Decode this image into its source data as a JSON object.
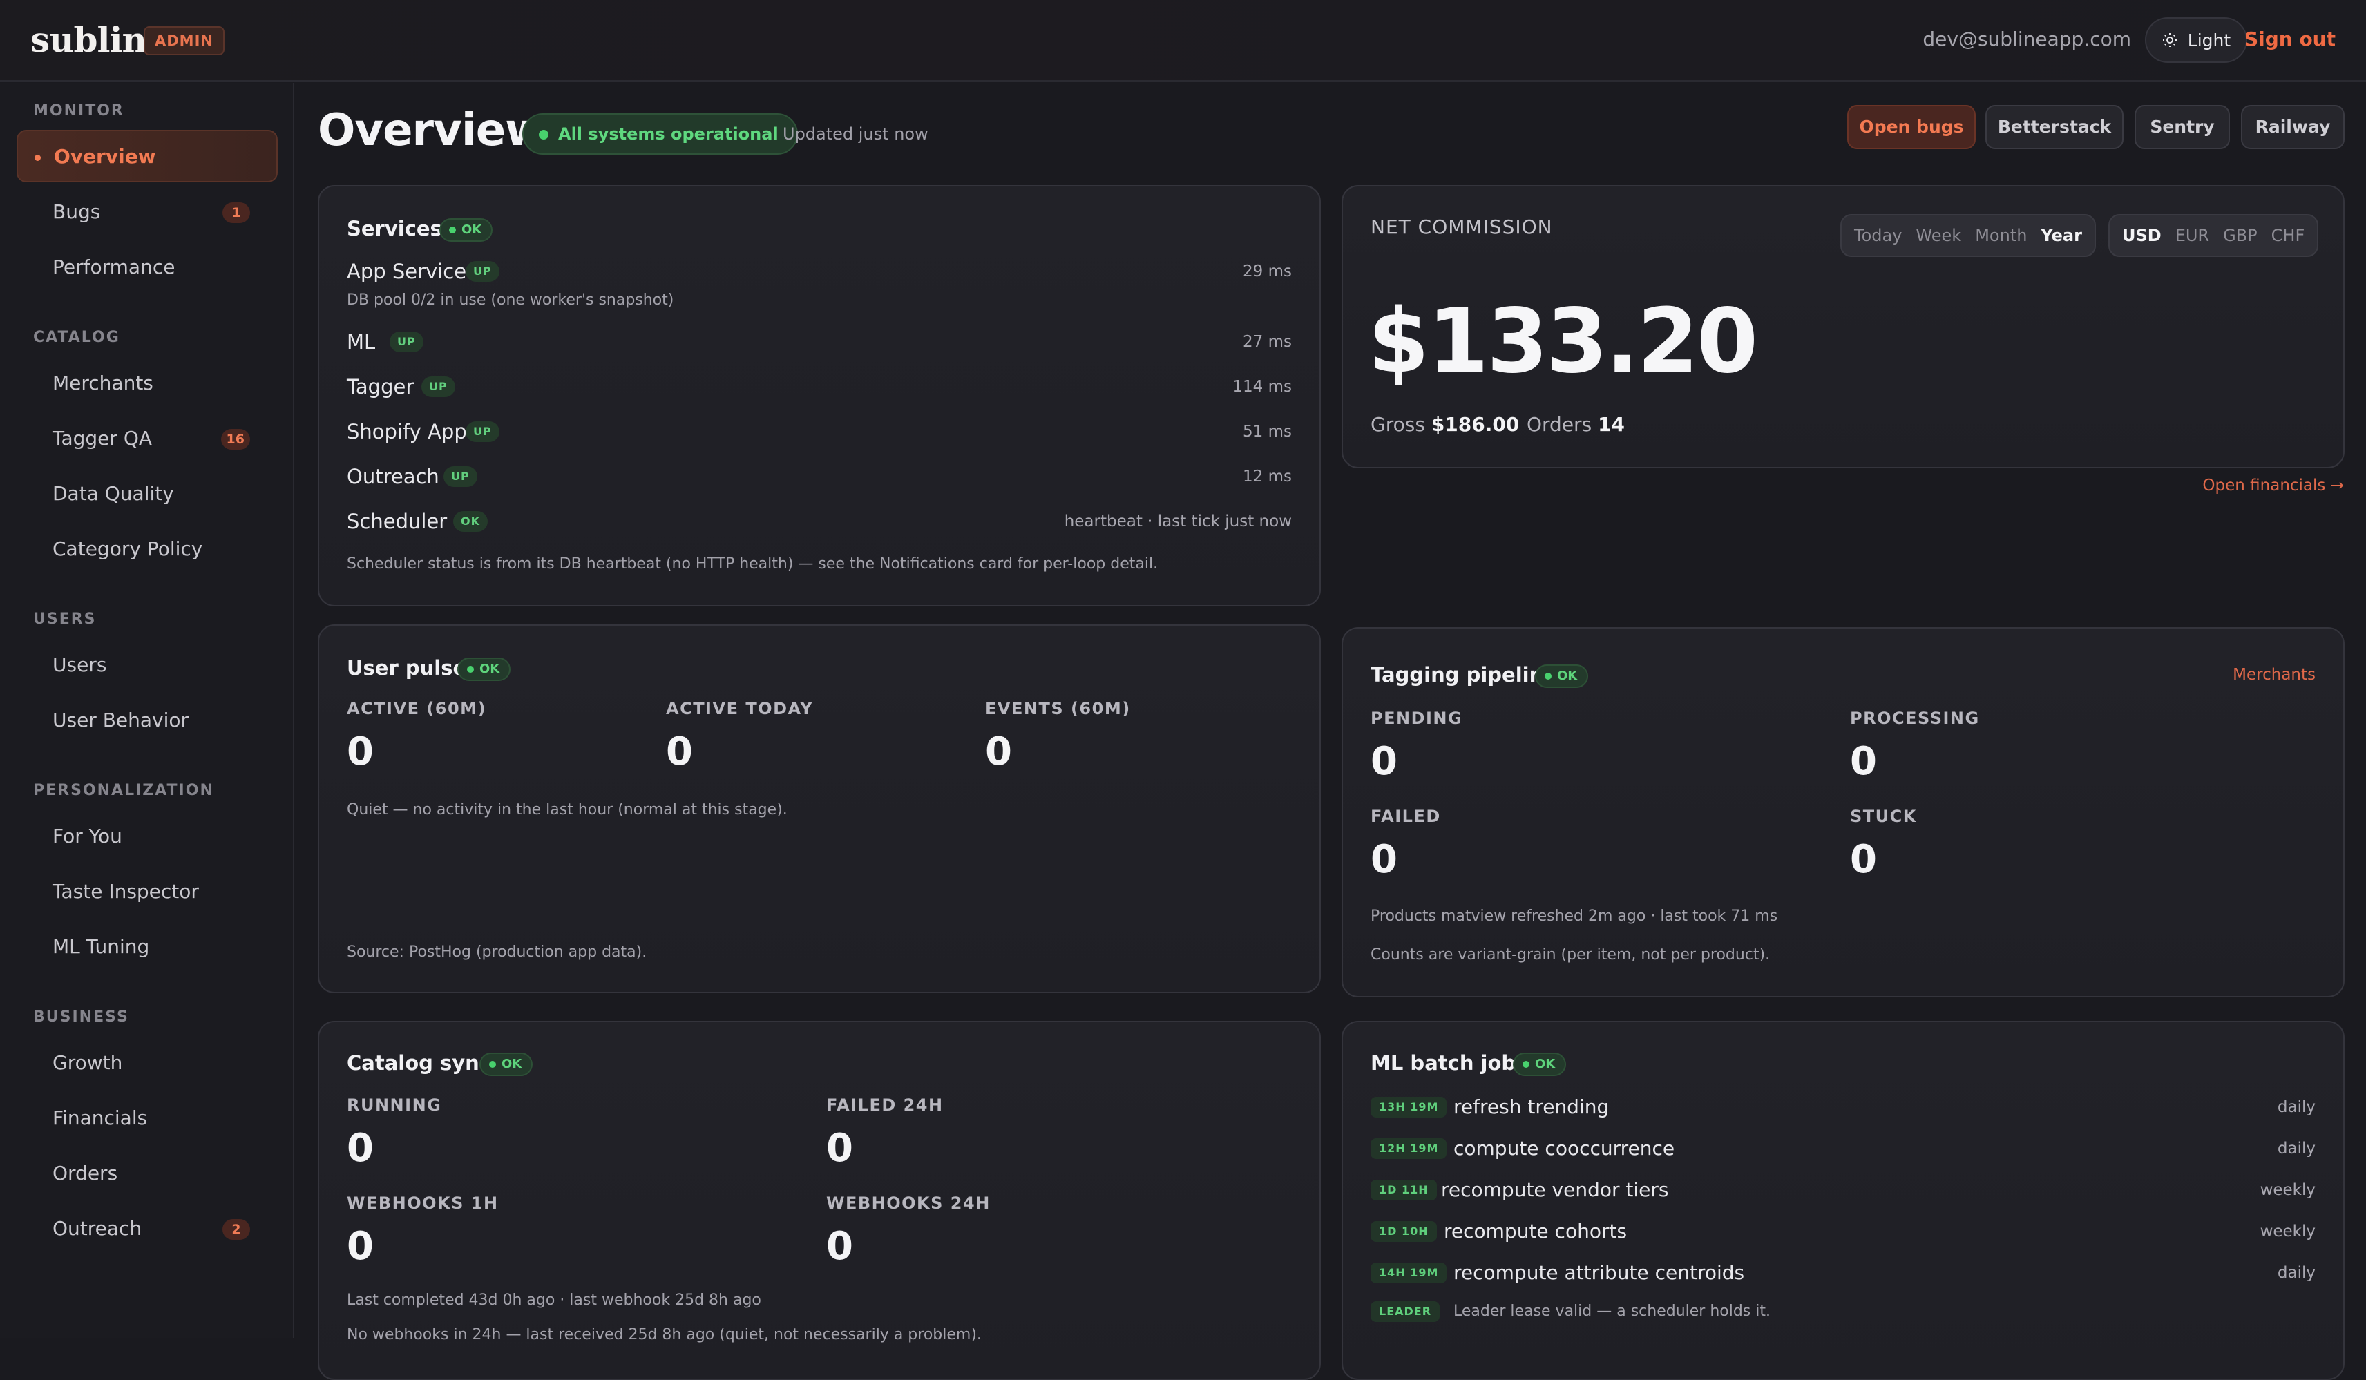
{
  "app": {
    "logo": "subline",
    "badge": "ADMIN",
    "user_email": "dev@sublineapp.com",
    "theme_label": "Light",
    "signout_label": "Sign out"
  },
  "sidebar": {
    "sections": [
      {
        "title": "MONITOR",
        "items": [
          {
            "label": "Overview",
            "active": true
          },
          {
            "label": "Bugs",
            "count": "1"
          },
          {
            "label": "Performance"
          }
        ]
      },
      {
        "title": "CATALOG",
        "items": [
          {
            "label": "Merchants"
          },
          {
            "label": "Tagger QA",
            "count": "16"
          },
          {
            "label": "Data Quality"
          },
          {
            "label": "Category Policy"
          }
        ]
      },
      {
        "title": "USERS",
        "items": [
          {
            "label": "Users"
          },
          {
            "label": "User Behavior"
          }
        ]
      },
      {
        "title": "PERSONALIZATION",
        "items": [
          {
            "label": "For You"
          },
          {
            "label": "Taste Inspector"
          },
          {
            "label": "ML Tuning"
          }
        ]
      },
      {
        "title": "BUSINESS",
        "items": [
          {
            "label": "Growth"
          },
          {
            "label": "Financials"
          },
          {
            "label": "Orders"
          },
          {
            "label": "Outreach",
            "count": "2"
          }
        ]
      }
    ]
  },
  "header": {
    "title": "Overview",
    "status": "All systems operational",
    "updated": "Updated just now",
    "links": [
      "Open bugs",
      "Betterstack",
      "Sentry",
      "Railway"
    ]
  },
  "services": {
    "title": "Services",
    "badge": "OK",
    "items": [
      {
        "name": "App Service",
        "status": "UP",
        "latency": "29 ms",
        "detail": "DB pool 0/2 in use (one worker's snapshot)"
      },
      {
        "name": "ML",
        "status": "UP",
        "latency": "27 ms"
      },
      {
        "name": "Tagger",
        "status": "UP",
        "latency": "114 ms"
      },
      {
        "name": "Shopify App",
        "status": "UP",
        "latency": "51 ms"
      },
      {
        "name": "Outreach",
        "status": "UP",
        "latency": "12 ms"
      },
      {
        "name": "Scheduler",
        "status": "OK",
        "latency": "heartbeat · last tick just now"
      }
    ],
    "footnote": "Scheduler status is from its DB heartbeat (no HTTP health) — see the Notifications card for per-loop detail."
  },
  "net_commission": {
    "label": "NET COMMISSION",
    "periods": [
      "Today",
      "Week",
      "Month",
      "Year"
    ],
    "active_period": "Year",
    "currencies": [
      "USD",
      "EUR",
      "GBP",
      "CHF"
    ],
    "active_currency": "USD",
    "amount": "$133.20",
    "gross_label": "Gross",
    "gross_value": "$186.00",
    "orders_label": "Orders",
    "orders_value": "14",
    "link": "Open financials →"
  },
  "user_pulse": {
    "title": "User pulse",
    "badge": "OK",
    "stats": [
      {
        "label": "ACTIVE (60M)",
        "value": "0"
      },
      {
        "label": "ACTIVE TODAY",
        "value": "0"
      },
      {
        "label": "EVENTS (60M)",
        "value": "0"
      }
    ],
    "note": "Quiet — no activity in the last hour (normal at this stage).",
    "source": "Source: PostHog (production app data)."
  },
  "tagging": {
    "title": "Tagging pipeline",
    "badge": "OK",
    "link": "Merchants",
    "stats": [
      {
        "label": "PENDING",
        "value": "0"
      },
      {
        "label": "PROCESSING",
        "value": "0"
      },
      {
        "label": "FAILED",
        "value": "0"
      },
      {
        "label": "STUCK",
        "value": "0"
      }
    ],
    "note1": "Products matview refreshed 2m ago · last took 71 ms",
    "note2": "Counts are variant-grain (per item, not per product)."
  },
  "catalog_sync": {
    "title": "Catalog sync",
    "badge": "OK",
    "stats": [
      {
        "label": "RUNNING",
        "value": "0"
      },
      {
        "label": "FAILED 24H",
        "value": "0"
      },
      {
        "label": "WEBHOOKS 1H",
        "value": "0"
      },
      {
        "label": "WEBHOOKS 24H",
        "value": "0"
      }
    ],
    "note1": "Last completed 43d 0h ago · last webhook 25d 8h ago",
    "note2": "No webhooks in 24h — last received 25d 8h ago (quiet, not necessarily a problem)."
  },
  "ml_jobs": {
    "title": "ML batch jobs",
    "badge": "OK",
    "jobs": [
      {
        "age": "13H 19M",
        "name": "refresh trending",
        "freq": "daily"
      },
      {
        "age": "12H 19M",
        "name": "compute cooccurrence",
        "freq": "daily"
      },
      {
        "age": "1D 11H",
        "name": "recompute vendor tiers",
        "freq": "weekly"
      },
      {
        "age": "1D 10H",
        "name": "recompute cohorts",
        "freq": "weekly"
      },
      {
        "age": "14H 19M",
        "name": "recompute attribute centroids",
        "freq": "daily"
      }
    ],
    "leader_badge": "LEADER",
    "leader_note": "Leader lease valid — a scheduler holds it."
  }
}
